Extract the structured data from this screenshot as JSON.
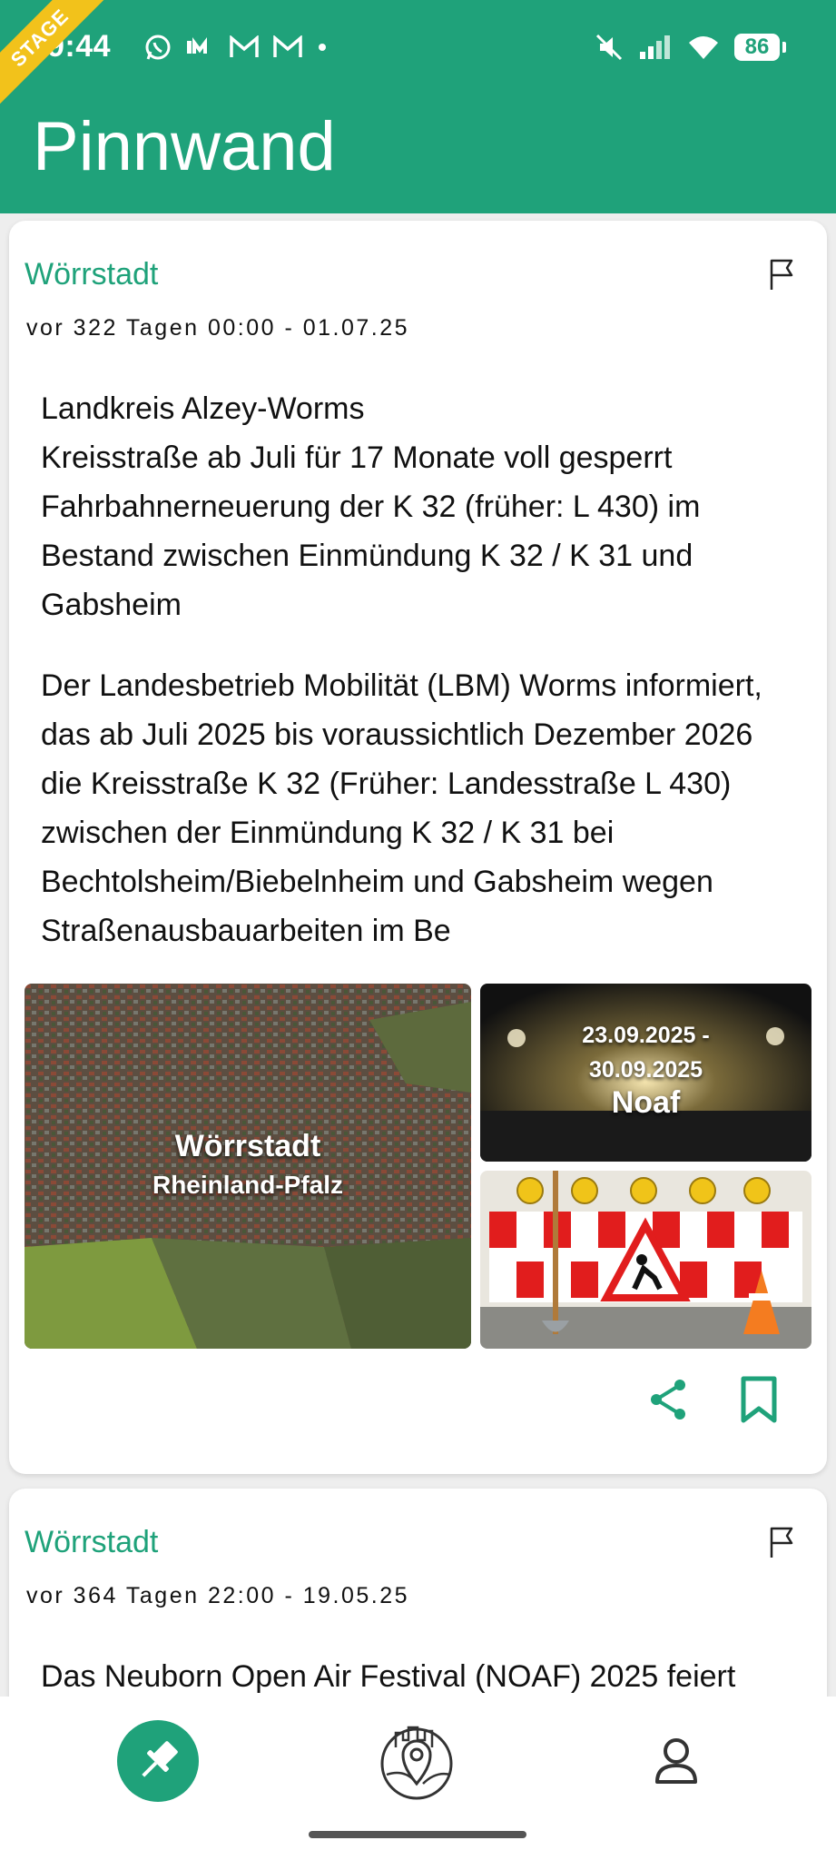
{
  "status_bar": {
    "time": "9:44",
    "ribbon": "STAGE",
    "battery": "86"
  },
  "header": {
    "title": "Pinnwand"
  },
  "posts": [
    {
      "location": "Wörrstadt",
      "meta": "vor 322 Tagen 00:00 - 01.07.25",
      "paragraphs": [
        "Landkreis Alzey-Worms\nKreisstraße ab Juli für 17 Monate voll gesperrt\nFahrbahnerneuerung der K 32 (früher: L 430) im Bestand zwischen Einmündung K 32 / K 31 und Gabsheim",
        "Der Landesbetrieb Mobilität (LBM) Worms informiert, das ab Juli 2025 bis voraussichtlich Dezember 2026 die Kreisstraße K 32 (Früher: Landesstraße L 430) zwischen der Einmündung K 32 / K 31 bei Bechtolsheim/Biebelnheim und Gabsheim wegen Straßenausbauarbeiten im Be"
      ],
      "images": {
        "main": {
          "title": "Wörrstadt",
          "subtitle": "Rheinland-Pfalz"
        },
        "top": {
          "date": "23.09.2025 -\n30.09.2025",
          "title": "Noaf"
        }
      }
    },
    {
      "location": "Wörrstadt",
      "meta": "vor 364 Tagen 22:00 - 19.05.25",
      "paragraphs": [
        "Das Neuborn Open Air Festival (NOAF) 2025 feiert"
      ]
    }
  ],
  "colors": {
    "brand": "#1fa27a",
    "ribbon": "#f2c21b"
  }
}
